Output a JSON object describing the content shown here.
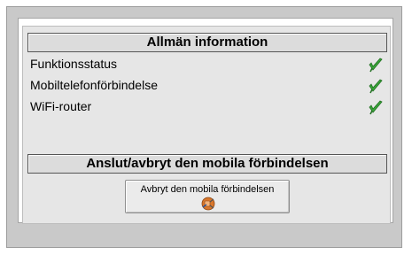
{
  "general": {
    "title": "Allmän information",
    "rows": [
      {
        "label": "Funktionsstatus",
        "status_icon": "green-check-icon"
      },
      {
        "label": "Mobiltelefonförbindelse",
        "status_icon": "green-check-icon"
      },
      {
        "label": "WiFi-router",
        "status_icon": "green-check-icon"
      }
    ]
  },
  "connection": {
    "title": "Anslut/avbryt den mobila förbindelsen",
    "button_label": "Avbryt den mobila förbindelsen",
    "button_icon": "disconnect-plug-icon"
  },
  "colors": {
    "check": "#3aa63a",
    "plug": "#d9772c"
  }
}
